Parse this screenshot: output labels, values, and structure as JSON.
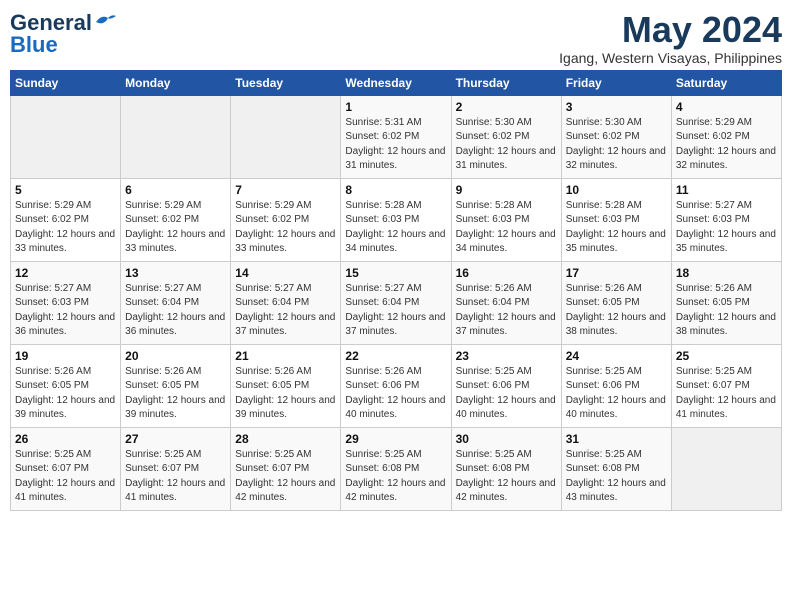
{
  "logo": {
    "general": "General",
    "blue": "Blue"
  },
  "title": "May 2024",
  "subtitle": "Igang, Western Visayas, Philippines",
  "days_header": [
    "Sunday",
    "Monday",
    "Tuesday",
    "Wednesday",
    "Thursday",
    "Friday",
    "Saturday"
  ],
  "weeks": [
    [
      {
        "day": "",
        "empty": true
      },
      {
        "day": "",
        "empty": true
      },
      {
        "day": "",
        "empty": true
      },
      {
        "day": "1",
        "sunrise": "5:31 AM",
        "sunset": "6:02 PM",
        "daylight": "12 hours and 31 minutes."
      },
      {
        "day": "2",
        "sunrise": "5:30 AM",
        "sunset": "6:02 PM",
        "daylight": "12 hours and 31 minutes."
      },
      {
        "day": "3",
        "sunrise": "5:30 AM",
        "sunset": "6:02 PM",
        "daylight": "12 hours and 32 minutes."
      },
      {
        "day": "4",
        "sunrise": "5:29 AM",
        "sunset": "6:02 PM",
        "daylight": "12 hours and 32 minutes."
      }
    ],
    [
      {
        "day": "5",
        "sunrise": "5:29 AM",
        "sunset": "6:02 PM",
        "daylight": "12 hours and 33 minutes."
      },
      {
        "day": "6",
        "sunrise": "5:29 AM",
        "sunset": "6:02 PM",
        "daylight": "12 hours and 33 minutes."
      },
      {
        "day": "7",
        "sunrise": "5:29 AM",
        "sunset": "6:02 PM",
        "daylight": "12 hours and 33 minutes."
      },
      {
        "day": "8",
        "sunrise": "5:28 AM",
        "sunset": "6:03 PM",
        "daylight": "12 hours and 34 minutes."
      },
      {
        "day": "9",
        "sunrise": "5:28 AM",
        "sunset": "6:03 PM",
        "daylight": "12 hours and 34 minutes."
      },
      {
        "day": "10",
        "sunrise": "5:28 AM",
        "sunset": "6:03 PM",
        "daylight": "12 hours and 35 minutes."
      },
      {
        "day": "11",
        "sunrise": "5:27 AM",
        "sunset": "6:03 PM",
        "daylight": "12 hours and 35 minutes."
      }
    ],
    [
      {
        "day": "12",
        "sunrise": "5:27 AM",
        "sunset": "6:03 PM",
        "daylight": "12 hours and 36 minutes."
      },
      {
        "day": "13",
        "sunrise": "5:27 AM",
        "sunset": "6:04 PM",
        "daylight": "12 hours and 36 minutes."
      },
      {
        "day": "14",
        "sunrise": "5:27 AM",
        "sunset": "6:04 PM",
        "daylight": "12 hours and 37 minutes."
      },
      {
        "day": "15",
        "sunrise": "5:27 AM",
        "sunset": "6:04 PM",
        "daylight": "12 hours and 37 minutes."
      },
      {
        "day": "16",
        "sunrise": "5:26 AM",
        "sunset": "6:04 PM",
        "daylight": "12 hours and 37 minutes."
      },
      {
        "day": "17",
        "sunrise": "5:26 AM",
        "sunset": "6:05 PM",
        "daylight": "12 hours and 38 minutes."
      },
      {
        "day": "18",
        "sunrise": "5:26 AM",
        "sunset": "6:05 PM",
        "daylight": "12 hours and 38 minutes."
      }
    ],
    [
      {
        "day": "19",
        "sunrise": "5:26 AM",
        "sunset": "6:05 PM",
        "daylight": "12 hours and 39 minutes."
      },
      {
        "day": "20",
        "sunrise": "5:26 AM",
        "sunset": "6:05 PM",
        "daylight": "12 hours and 39 minutes."
      },
      {
        "day": "21",
        "sunrise": "5:26 AM",
        "sunset": "6:05 PM",
        "daylight": "12 hours and 39 minutes."
      },
      {
        "day": "22",
        "sunrise": "5:26 AM",
        "sunset": "6:06 PM",
        "daylight": "12 hours and 40 minutes."
      },
      {
        "day": "23",
        "sunrise": "5:25 AM",
        "sunset": "6:06 PM",
        "daylight": "12 hours and 40 minutes."
      },
      {
        "day": "24",
        "sunrise": "5:25 AM",
        "sunset": "6:06 PM",
        "daylight": "12 hours and 40 minutes."
      },
      {
        "day": "25",
        "sunrise": "5:25 AM",
        "sunset": "6:07 PM",
        "daylight": "12 hours and 41 minutes."
      }
    ],
    [
      {
        "day": "26",
        "sunrise": "5:25 AM",
        "sunset": "6:07 PM",
        "daylight": "12 hours and 41 minutes."
      },
      {
        "day": "27",
        "sunrise": "5:25 AM",
        "sunset": "6:07 PM",
        "daylight": "12 hours and 41 minutes."
      },
      {
        "day": "28",
        "sunrise": "5:25 AM",
        "sunset": "6:07 PM",
        "daylight": "12 hours and 42 minutes."
      },
      {
        "day": "29",
        "sunrise": "5:25 AM",
        "sunset": "6:08 PM",
        "daylight": "12 hours and 42 minutes."
      },
      {
        "day": "30",
        "sunrise": "5:25 AM",
        "sunset": "6:08 PM",
        "daylight": "12 hours and 42 minutes."
      },
      {
        "day": "31",
        "sunrise": "5:25 AM",
        "sunset": "6:08 PM",
        "daylight": "12 hours and 43 minutes."
      },
      {
        "day": "",
        "empty": true
      }
    ]
  ]
}
